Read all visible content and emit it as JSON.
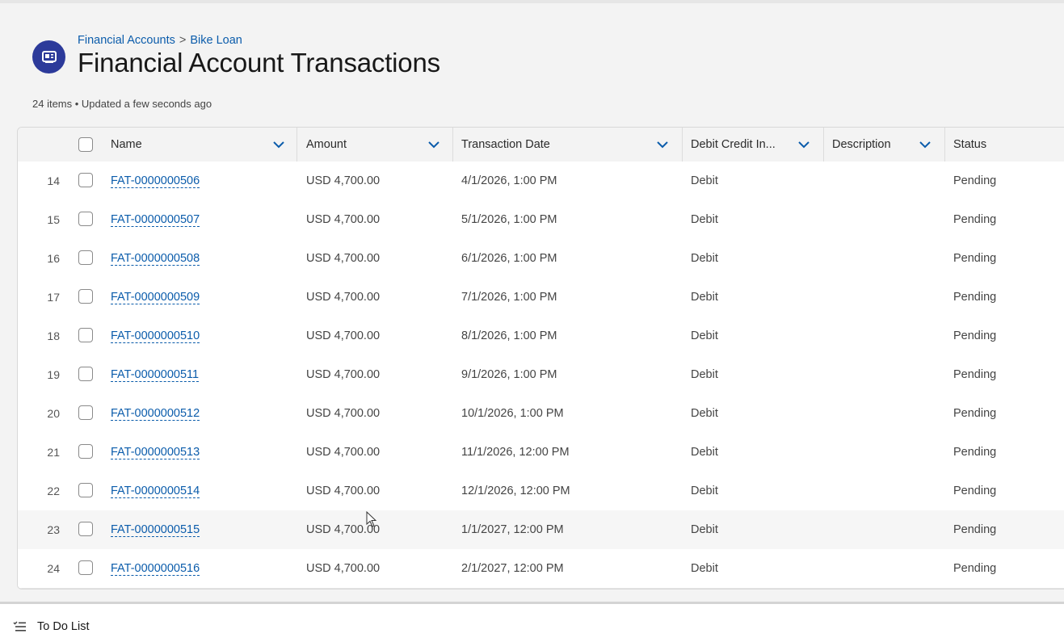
{
  "breadcrumb": {
    "parent": "Financial Accounts",
    "separator": ">",
    "current": "Bike Loan"
  },
  "page": {
    "title": "Financial Account Transactions",
    "subtitle": "24 items • Updated a few seconds ago",
    "icon": "financial-account-icon"
  },
  "columns": {
    "name": "Name",
    "amount": "Amount",
    "transaction_date": "Transaction Date",
    "debit_credit": "Debit Credit In...",
    "description": "Description",
    "status": "Status"
  },
  "rows": [
    {
      "num": "14",
      "name": "FAT-0000000506",
      "amount": "USD 4,700.00",
      "date": "4/1/2026, 1:00 PM",
      "type": "Debit",
      "description": "",
      "status": "Pending"
    },
    {
      "num": "15",
      "name": "FAT-0000000507",
      "amount": "USD 4,700.00",
      "date": "5/1/2026, 1:00 PM",
      "type": "Debit",
      "description": "",
      "status": "Pending"
    },
    {
      "num": "16",
      "name": "FAT-0000000508",
      "amount": "USD 4,700.00",
      "date": "6/1/2026, 1:00 PM",
      "type": "Debit",
      "description": "",
      "status": "Pending"
    },
    {
      "num": "17",
      "name": "FAT-0000000509",
      "amount": "USD 4,700.00",
      "date": "7/1/2026, 1:00 PM",
      "type": "Debit",
      "description": "",
      "status": "Pending"
    },
    {
      "num": "18",
      "name": "FAT-0000000510",
      "amount": "USD 4,700.00",
      "date": "8/1/2026, 1:00 PM",
      "type": "Debit",
      "description": "",
      "status": "Pending"
    },
    {
      "num": "19",
      "name": "FAT-0000000511",
      "amount": "USD 4,700.00",
      "date": "9/1/2026, 1:00 PM",
      "type": "Debit",
      "description": "",
      "status": "Pending"
    },
    {
      "num": "20",
      "name": "FAT-0000000512",
      "amount": "USD 4,700.00",
      "date": "10/1/2026, 1:00 PM",
      "type": "Debit",
      "description": "",
      "status": "Pending"
    },
    {
      "num": "21",
      "name": "FAT-0000000513",
      "amount": "USD 4,700.00",
      "date": "11/1/2026, 12:00 PM",
      "type": "Debit",
      "description": "",
      "status": "Pending"
    },
    {
      "num": "22",
      "name": "FAT-0000000514",
      "amount": "USD 4,700.00",
      "date": "12/1/2026, 12:00 PM",
      "type": "Debit",
      "description": "",
      "status": "Pending"
    },
    {
      "num": "23",
      "name": "FAT-0000000515",
      "amount": "USD 4,700.00",
      "date": "1/1/2027, 12:00 PM",
      "type": "Debit",
      "description": "",
      "status": "Pending"
    },
    {
      "num": "24",
      "name": "FAT-0000000516",
      "amount": "USD 4,700.00",
      "date": "2/1/2027, 12:00 PM",
      "type": "Debit",
      "description": "",
      "status": "Pending"
    }
  ],
  "footer": {
    "todo_label": "To Do List",
    "icon": "checklist-icon"
  },
  "colors": {
    "accent": "#0b5cab",
    "icon_bg": "#2c3a9a"
  }
}
